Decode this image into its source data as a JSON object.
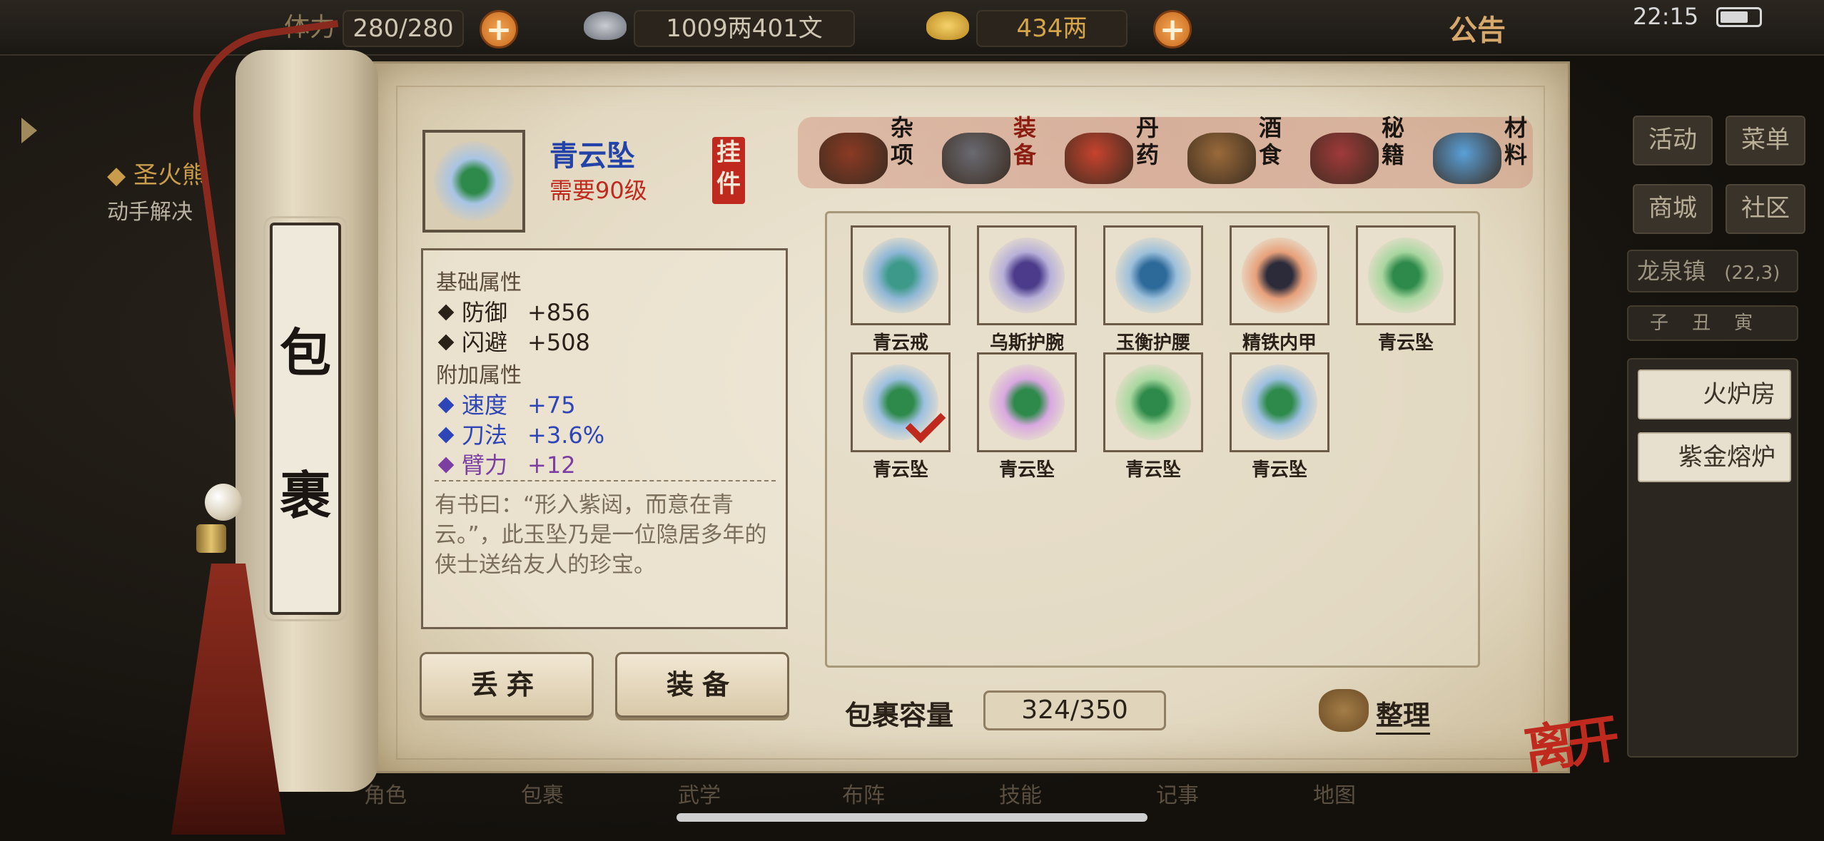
{
  "status_bar": {
    "time": "22:15"
  },
  "top_bar": {
    "stamina_label": "体力",
    "stamina": "280/280",
    "silver": "1009两401文",
    "gold": "434两",
    "notice": "公告"
  },
  "quest": {
    "title": "圣火熊",
    "subtitle": "动手解决"
  },
  "right_panel": {
    "buttons": [
      "活动",
      "菜单",
      "商城",
      "社区"
    ],
    "location": "龙泉镇",
    "coords": "(22,3)",
    "time_marks": [
      "子",
      "丑",
      "寅"
    ],
    "forge_buttons": [
      "火炉房",
      "紫金熔炉"
    ]
  },
  "bottom_nav": [
    "角色",
    "包裹",
    "武学",
    "布阵",
    "技能",
    "记事",
    "地图"
  ],
  "scroll_title": [
    "包",
    "裹"
  ],
  "selected_item": {
    "name": "青云坠",
    "requirement": "需要90级",
    "slot_stamp": "挂件",
    "base_header": "基础属性",
    "base_attrs": [
      {
        "name": "防御",
        "value": "+856"
      },
      {
        "name": "闪避",
        "value": "+508"
      }
    ],
    "extra_header": "附加属性",
    "extra_attrs": [
      {
        "name": "速度",
        "value": "+75"
      },
      {
        "name": "刀法",
        "value": "+3.6%"
      },
      {
        "name": "臂力",
        "value": "+12"
      }
    ],
    "description": "有书曰：“形入紫闼，而意在青云。”，此玉坠乃是一位隐居多年的侠士送给友人的珍宝。"
  },
  "buttons": {
    "discard": "丢弃",
    "equip": "装备",
    "sort": "整理",
    "leave": "离开"
  },
  "tabs": [
    {
      "label": "杂项",
      "active": false,
      "color": "#8a3a24"
    },
    {
      "label": "装备",
      "active": true,
      "color": "#6a6a72"
    },
    {
      "label": "丹药",
      "active": false,
      "color": "#c6432e"
    },
    {
      "label": "酒食",
      "active": false,
      "color": "#9a6a3a"
    },
    {
      "label": "秘籍",
      "active": false,
      "color": "#a03a3a"
    },
    {
      "label": "材料",
      "active": false,
      "color": "#5aa0d8"
    }
  ],
  "inventory": [
    {
      "name": "青云戒",
      "color": "#3d9a8a",
      "bg": "#8fb7d6",
      "selected": false
    },
    {
      "name": "乌斯护腕",
      "color": "#4b3b8a",
      "bg": "#b7b0d8",
      "selected": false
    },
    {
      "name": "玉衡护腰",
      "color": "#2d6a9a",
      "bg": "#9cc0da",
      "selected": false
    },
    {
      "name": "精铁内甲",
      "color": "#2b2b3a",
      "bg": "#e7a07a",
      "selected": false
    },
    {
      "name": "青云坠",
      "color": "#2e8a4a",
      "bg": "#a8d6a0",
      "selected": false
    },
    {
      "name": "青云坠",
      "color": "#2e8a4a",
      "bg": "#9cc0e0",
      "selected": true
    },
    {
      "name": "青云坠",
      "color": "#2e8a4a",
      "bg": "#d8a8e0",
      "selected": false
    },
    {
      "name": "青云坠",
      "color": "#2e8a4a",
      "bg": "#a8d8a0",
      "selected": false
    },
    {
      "name": "青云坠",
      "color": "#2e8a4a",
      "bg": "#9cc0e0",
      "selected": false
    }
  ],
  "capacity": {
    "label": "包裹容量",
    "value": "324/350"
  }
}
